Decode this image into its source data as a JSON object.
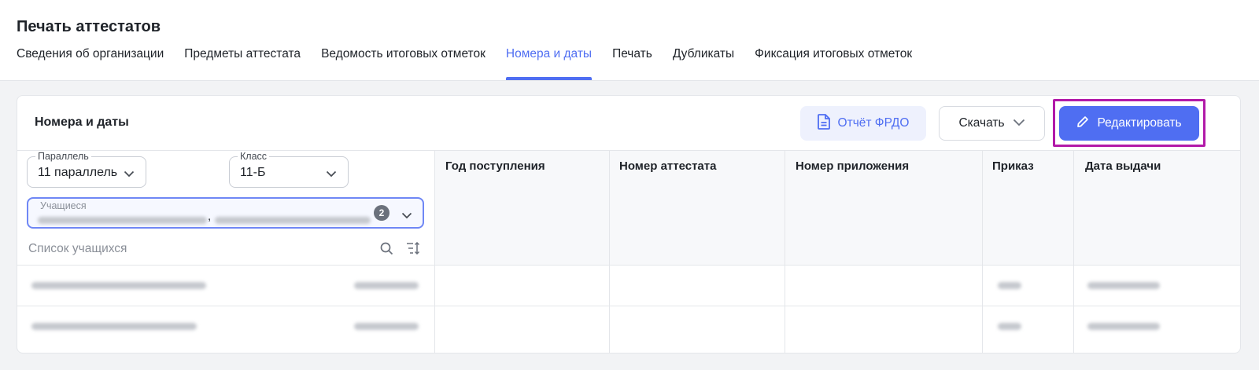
{
  "page": {
    "title": "Печать аттестатов",
    "tabs": [
      {
        "label": "Сведения об организации",
        "active": false
      },
      {
        "label": "Предметы аттестата",
        "active": false
      },
      {
        "label": "Ведомость итоговых отметок",
        "active": false
      },
      {
        "label": "Номера и даты",
        "active": true
      },
      {
        "label": "Печать",
        "active": false
      },
      {
        "label": "Дубликаты",
        "active": false
      },
      {
        "label": "Фиксация итоговых отметок",
        "active": false
      }
    ]
  },
  "card": {
    "title": "Номера и даты",
    "report_button": "Отчёт ФРДО",
    "download_button": "Скачать",
    "edit_button": "Редактировать"
  },
  "filters": {
    "parallel_label": "Параллель",
    "parallel_value": "11 параллель",
    "class_label": "Класс",
    "class_value": "11-Б",
    "students_label": "Учащиеся",
    "students_count": "2",
    "students_separator": ",",
    "list_placeholder": "Список учащихся"
  },
  "columns": [
    "Год поступления",
    "Номер аттестата",
    "Номер приложения",
    "Приказ",
    "Дата выдачи"
  ],
  "colors": {
    "accent": "#4f6ef2",
    "highlight": "#b21aa8"
  },
  "icons": [
    "document-icon",
    "chevron-down-icon",
    "pencil-icon",
    "search-icon",
    "sort-filter-icon"
  ]
}
